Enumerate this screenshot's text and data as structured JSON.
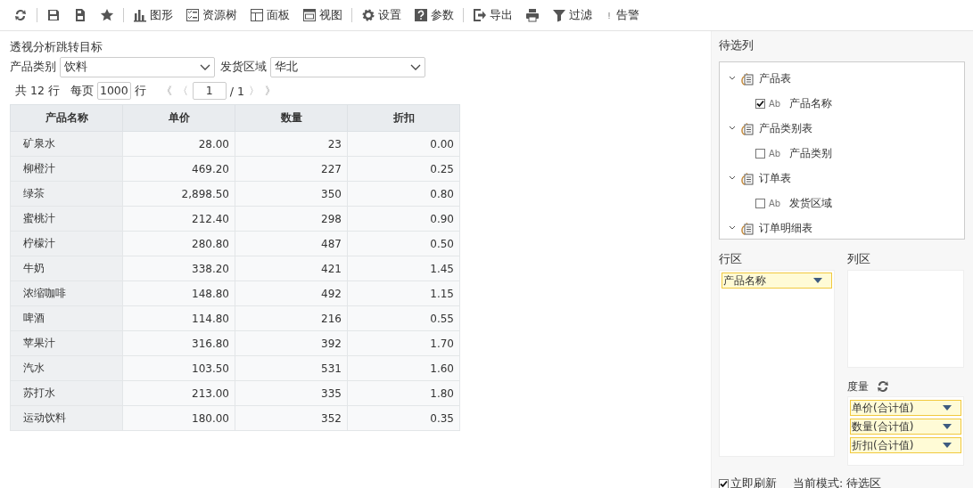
{
  "toolbar": [
    {
      "kind": "refresh"
    },
    {
      "kind": "separator"
    },
    {
      "kind": "save"
    },
    {
      "kind": "save-as"
    },
    {
      "kind": "star"
    },
    {
      "kind": "separator"
    },
    {
      "kind": "chart",
      "label": "图形"
    },
    {
      "kind": "tree",
      "label": "资源树"
    },
    {
      "kind": "panel",
      "label": "面板"
    },
    {
      "kind": "view",
      "label": "视图"
    },
    {
      "kind": "separator"
    },
    {
      "kind": "gear",
      "label": "设置"
    },
    {
      "kind": "help",
      "label": "参数"
    },
    {
      "kind": "separator"
    },
    {
      "kind": "export",
      "label": "导出"
    },
    {
      "kind": "print"
    },
    {
      "kind": "filter",
      "label": "过滤"
    },
    {
      "kind": "alert",
      "label": "告警"
    }
  ],
  "report": {
    "title": "透视分析跳转目标",
    "filters": [
      {
        "label": "产品类别",
        "value": "饮料"
      },
      {
        "label": "发货区域",
        "value": "华北"
      }
    ],
    "pager": {
      "total": "共 12 行",
      "per_page_label": "每页",
      "per_page": "1000",
      "rows_unit": "行",
      "first": "《",
      "prev": "〈",
      "page": "1",
      "page_count": "/ 1",
      "next": "〉",
      "last": "》"
    },
    "table": {
      "columns": [
        "产品名称",
        "单价",
        "数量",
        "折扣"
      ],
      "rows": [
        [
          "矿泉水",
          "28.00",
          "23",
          "0.00"
        ],
        [
          "柳橙汁",
          "469.20",
          "227",
          "0.25"
        ],
        [
          "绿茶",
          "2,898.50",
          "350",
          "0.80"
        ],
        [
          "蜜桃汁",
          "212.40",
          "298",
          "0.90"
        ],
        [
          "柠檬汁",
          "280.80",
          "487",
          "0.50"
        ],
        [
          "牛奶",
          "338.20",
          "421",
          "1.45"
        ],
        [
          "浓缩咖啡",
          "148.80",
          "492",
          "1.15"
        ],
        [
          "啤酒",
          "114.80",
          "216",
          "0.55"
        ],
        [
          "苹果汁",
          "316.80",
          "392",
          "1.70"
        ],
        [
          "汽水",
          "103.50",
          "531",
          "1.60"
        ],
        [
          "苏打水",
          "213.00",
          "335",
          "1.80"
        ],
        [
          "运动饮料",
          "180.00",
          "352",
          "0.35"
        ]
      ]
    }
  },
  "side_panel": {
    "candidates_label": "待选列",
    "tree": [
      {
        "label": "产品表",
        "expanded": true,
        "children": [
          {
            "type_label": "Ab",
            "label": "产品名称",
            "checked": true
          }
        ]
      },
      {
        "label": "产品类别表",
        "expanded": true,
        "children": [
          {
            "type_label": "Ab",
            "label": "产品类别",
            "checked": false
          }
        ]
      },
      {
        "label": "订单表",
        "expanded": true,
        "children": [
          {
            "type_label": "Ab",
            "label": "发货区域",
            "checked": false
          }
        ]
      },
      {
        "label": "订单明细表",
        "expanded": true
      }
    ],
    "row_area": {
      "label": "行区",
      "items": [
        "产品名称"
      ]
    },
    "column_area": {
      "label": "列区"
    },
    "measures": {
      "label": "度量",
      "items": [
        "单价(合计值)",
        "数量(合计值)",
        "折扣(合计值)"
      ]
    },
    "auto_refresh": {
      "label": "立即刷新",
      "checked": true
    },
    "mode": "当前模式: 待选区"
  }
}
